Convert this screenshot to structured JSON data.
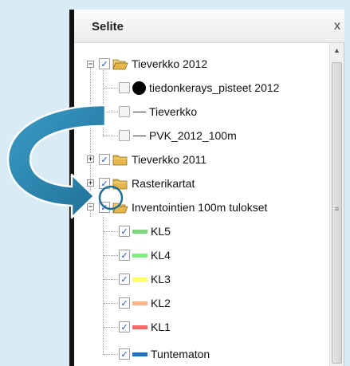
{
  "panel": {
    "title": "Selite",
    "close_symbol": "x"
  },
  "layers": [
    {
      "label": "Tieverkko 2012",
      "checked": true,
      "type": "folder",
      "expanded": true,
      "expander": "−"
    },
    {
      "label": "tiedonkerays_pisteet 2012",
      "checked": false,
      "symbol": "dot",
      "color": "#000000"
    },
    {
      "label": "Tieverkko",
      "checked": false,
      "symbol": "line",
      "color": "#333333"
    },
    {
      "label": "PVK_2012_100m",
      "checked": false,
      "symbol": "line",
      "color": "#333333"
    },
    {
      "label": "Tieverkko 2011",
      "checked": true,
      "type": "folder",
      "expanded": false,
      "expander": "+"
    },
    {
      "label": "Rasterikartat",
      "checked": true,
      "type": "folder",
      "expanded": false,
      "expander": "+"
    },
    {
      "label": "Inventointien 100m tulokset",
      "checked": true,
      "type": "folder",
      "expanded": true,
      "expander": "−"
    },
    {
      "label": "KL5",
      "checked": true,
      "symbol": "swatch",
      "color": "#7fd67f"
    },
    {
      "label": "KL4",
      "checked": true,
      "symbol": "swatch",
      "color": "#7ff07f"
    },
    {
      "label": "KL3",
      "checked": true,
      "symbol": "swatch",
      "color": "#ffff66"
    },
    {
      "label": "KL2",
      "checked": true,
      "symbol": "swatch",
      "color": "#ffb48a"
    },
    {
      "label": "KL1",
      "checked": true,
      "symbol": "swatch",
      "color": "#f76a6a"
    },
    {
      "label": "Tuntematon",
      "checked": true,
      "symbol": "swatch",
      "color": "#1a6fc9"
    }
  ],
  "colors": {
    "annotation_arrow": "#2b86b0",
    "check_mark": "#2a4fb4",
    "folder": "#e6b64a"
  },
  "icons": {
    "checkbox_check": "✓",
    "scroll_up": "▲",
    "scroll_grip": "≡"
  }
}
